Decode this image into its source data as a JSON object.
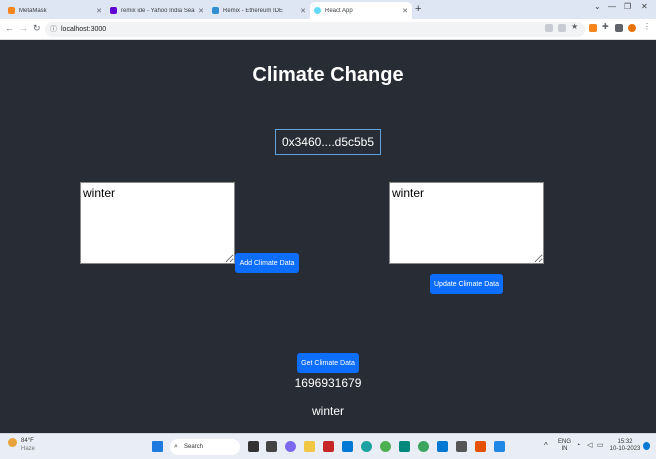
{
  "browser": {
    "tabs": [
      {
        "label": "MetaMask",
        "color": "#f6851b"
      },
      {
        "label": "remix ide - Yahoo India Search R",
        "color": "#6001d2"
      },
      {
        "label": "Remix - Ethereum IDE",
        "color": "#2f8fd1"
      },
      {
        "label": "React App",
        "color": "#61dafb"
      }
    ],
    "url": "localhost:3000"
  },
  "app": {
    "title": "Climate Change",
    "account": "0x3460....d5c5b5",
    "add_input_value": "winter",
    "add_button": "Add Climate Data",
    "update_input_value": "winter",
    "update_button": "Update Climate Data",
    "get_button": "Get Climate Data",
    "result_timestamp": "1696931679",
    "result_value": "winter"
  },
  "taskbar": {
    "weather_temp": "84°F",
    "weather_desc": "Haze",
    "search_label": "Search",
    "lang_top": "ENG",
    "lang_bottom": "IN",
    "time": "15:32",
    "date": "10-10-2023"
  }
}
